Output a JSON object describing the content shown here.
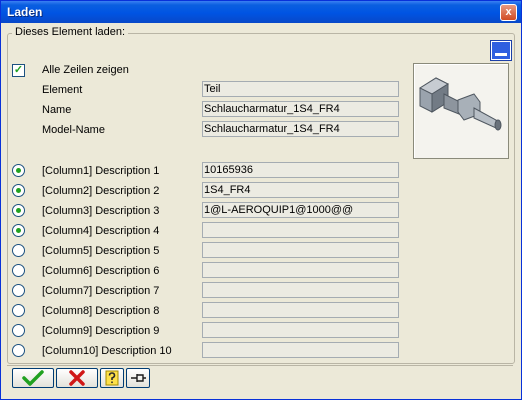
{
  "window": {
    "title": "Laden",
    "close_label": "x"
  },
  "group": {
    "legend": "Dieses Element laden:"
  },
  "show_all_rows": {
    "label": "Alle Zeilen zeigen",
    "checked": true
  },
  "info_fields": [
    {
      "label": "Element",
      "value": "Teil"
    },
    {
      "label": "Name",
      "value": "Schlaucharmatur_1S4_FR4"
    },
    {
      "label": "Model-Name",
      "value": "Schlaucharmatur_1S4_FR4"
    }
  ],
  "columns": [
    {
      "label": "[Column1] Description 1",
      "value": "10165936",
      "selected": true
    },
    {
      "label": "[Column2] Description 2",
      "value": "1S4_FR4",
      "selected": true
    },
    {
      "label": "[Column3] Description 3",
      "value": "1@L-AEROQUIP1@1000@@",
      "selected": true
    },
    {
      "label": "[Column4] Description 4",
      "value": "",
      "selected": true
    },
    {
      "label": "[Column5] Description 5",
      "value": "",
      "selected": false
    },
    {
      "label": "[Column6] Description 6",
      "value": "",
      "selected": false
    },
    {
      "label": "[Column7] Description 7",
      "value": "",
      "selected": false
    },
    {
      "label": "[Column8] Description 8",
      "value": "",
      "selected": false
    },
    {
      "label": "[Column9] Description 9",
      "value": "",
      "selected": false
    },
    {
      "label": "[Column10] Description 10",
      "value": "",
      "selected": false
    }
  ],
  "toolbar": {
    "ok_icon": "checkmark-icon",
    "cancel_icon": "cross-icon",
    "help_icon": "question-icon",
    "pin_icon": "pin-icon"
  },
  "colors": {
    "title_bar": "#0054e3",
    "check_green": "#21a121",
    "cancel_red": "#d01818"
  }
}
